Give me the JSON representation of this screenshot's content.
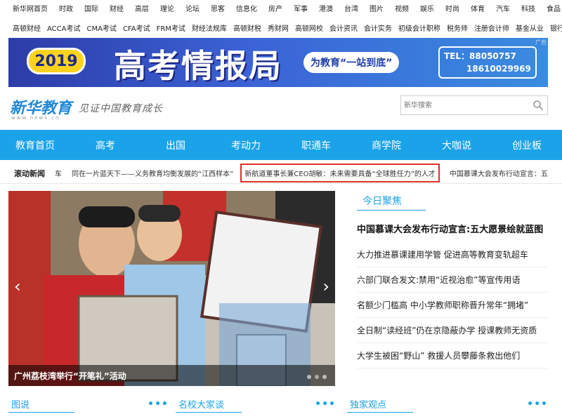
{
  "topnav": [
    "新华网首页",
    "时政",
    "国际",
    "财经",
    "高层",
    "理论",
    "论坛",
    "思客",
    "信息化",
    "房产",
    "军事",
    "港澳",
    "台湾",
    "图片",
    "视频",
    "娱乐",
    "时尚",
    "体育",
    "汽车",
    "科技",
    "食品"
  ],
  "subnav": [
    "高顿财经",
    "ACCA考试",
    "CMA考试",
    "CFA考试",
    "FRM考试",
    "财经法规库",
    "高顿财税",
    "秀财网",
    "高顿网校",
    "会计资讯",
    "会计实务",
    "初级会计职称",
    "税务师",
    "注册会计师",
    "基金从业",
    "银行招聘"
  ],
  "banner": {
    "year": "2019",
    "headline": "高考情报局",
    "slogan": "为教育“一站到底”",
    "tel_label": "TEL：",
    "tel1": "88050757",
    "tel2": "18610029969",
    "ad_tag": "广告"
  },
  "logo": {
    "name": "新华教育",
    "domain": "www.news.cn",
    "tagline": "见证中国教育成长"
  },
  "search": {
    "placeholder": "新华搜索"
  },
  "mainnav": [
    "教育首页",
    "高考",
    "出国",
    "考动力",
    "职通车",
    "商学院",
    "大咖说",
    "创业板"
  ],
  "ticker": {
    "label": "滚动新闻",
    "item0": "车",
    "item1": "同在一片蓝天下——义务教育均衡发展的“江西样本”",
    "item2": "新航道董事长兼CEO胡敏：未来需要具备“全球胜任力”的人才",
    "item3": "中国慕课大会发布行动宣言：五"
  },
  "slider": {
    "caption": "广州荔枝湾举行“开笔礼”活动",
    "prev": "‹",
    "next": "›"
  },
  "focus": {
    "title": "今日聚焦",
    "lead": "中国慕课大会发布行动宣言:五大愿景绘就蓝图",
    "items": [
      "大力推进慕课建用学管 促进高等教育变轨超车",
      "六部门联合发文:禁用“近视治愈”等宣传用语",
      "名额少门槛高 中小学教师职称晋升常年“拥堵”",
      "全日制“读经班”仍在京隐蔽办学 授课教师无资质",
      "大学生被困“野山” 救援人员攀藤条救出他们"
    ]
  },
  "sections": [
    {
      "name": "图说",
      "more": "•••"
    },
    {
      "name": "名校大家谈",
      "more": "•••"
    },
    {
      "name": "独家观点",
      "more": "•••"
    }
  ],
  "colors": {
    "accent": "#1aa3e8",
    "highlight_border": "#e0302a",
    "banner_bg": "#2d3ca8"
  }
}
